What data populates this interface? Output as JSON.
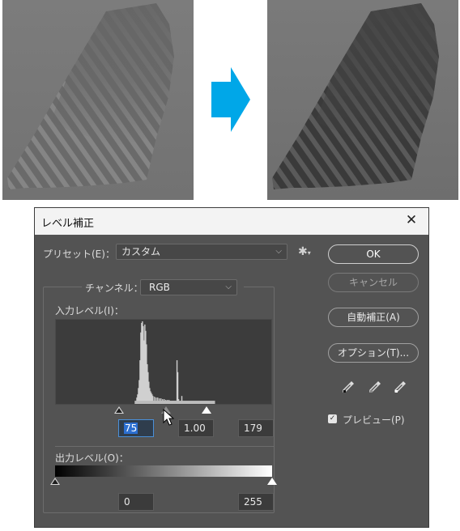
{
  "images": {
    "before_name": "before-photo",
    "after_name": "after-photo"
  },
  "arrow_color": "#00a7e8",
  "dialog": {
    "title": "レベル補正",
    "close_glyph": "✕",
    "preset_label": "プリセット(E)：",
    "preset_value": "カスタム",
    "gear_glyph": "✱",
    "channel_label": "チャンネル：",
    "channel_value": "RGB",
    "input_levels_label": "入力レベル(I)：",
    "input_black": "75",
    "input_gamma": "1.00",
    "input_white": "179",
    "output_levels_label": "出力レベル(O)：",
    "output_black": "0",
    "output_white": "255",
    "buttons": {
      "ok": "OK",
      "cancel": "キャンセル",
      "auto": "自動補正(A)",
      "options": "オプション(T)..."
    },
    "preview_label": "プレビュー(P)",
    "preview_checked": true,
    "check_glyph": "✓"
  }
}
